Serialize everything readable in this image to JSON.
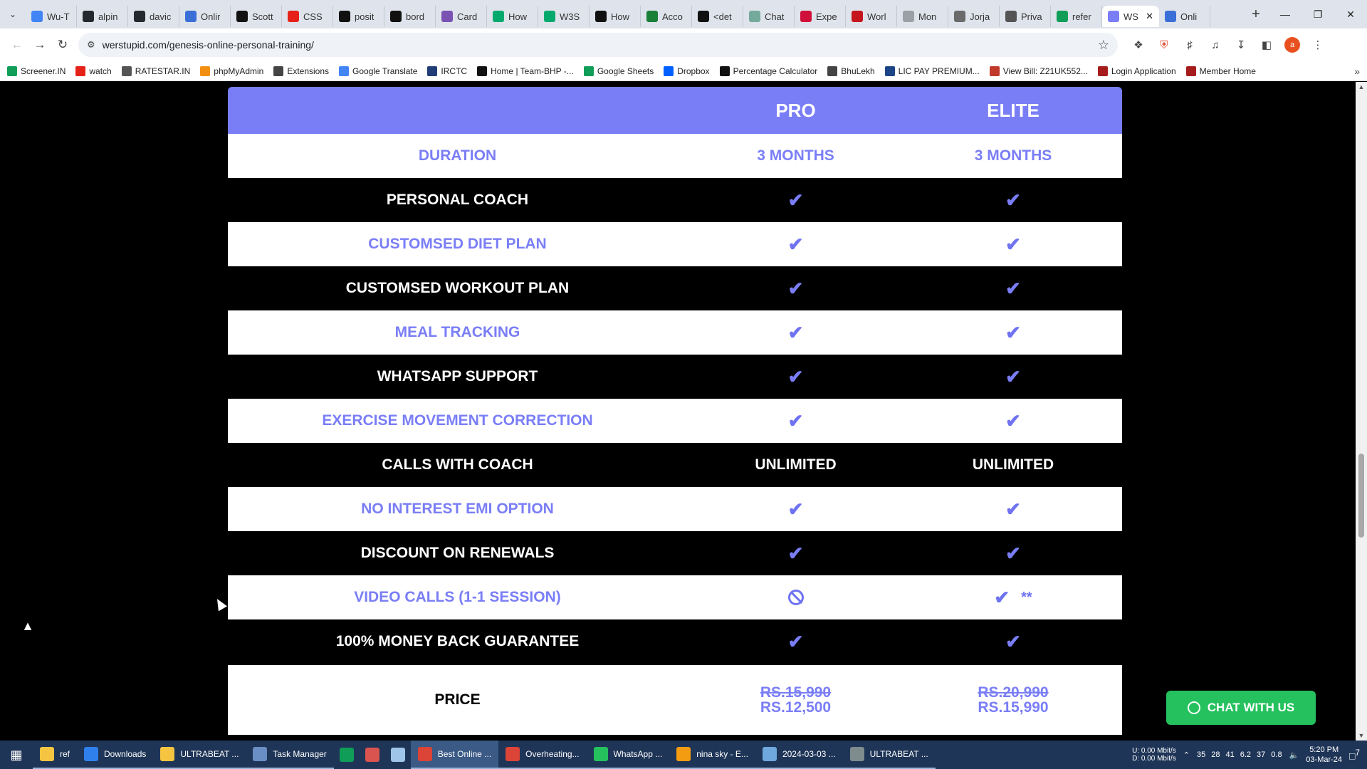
{
  "browser": {
    "tabs": [
      {
        "title": "Wu-T",
        "icon": "google-icon",
        "color": "#4285f4"
      },
      {
        "title": "alpin",
        "icon": "github-icon",
        "color": "#24292f"
      },
      {
        "title": "davic",
        "icon": "github-icon",
        "color": "#24292f"
      },
      {
        "title": "Onlir",
        "icon": "mentor-icon",
        "color": "#3b6fd8"
      },
      {
        "title": "Scott",
        "icon": "s-icon",
        "color": "#111111"
      },
      {
        "title": "CSS",
        "icon": "youtube-icon",
        "color": "#e62117"
      },
      {
        "title": "posit",
        "icon": "medium-icon",
        "color": "#111111"
      },
      {
        "title": "bord",
        "icon": "medium-icon",
        "color": "#111111"
      },
      {
        "title": "Card",
        "icon": "bootstrap-icon",
        "color": "#7952b3"
      },
      {
        "title": "How",
        "icon": "w3-icon",
        "color": "#04aa6d"
      },
      {
        "title": "W3S",
        "icon": "w3-icon",
        "color": "#04aa6d"
      },
      {
        "title": "How",
        "icon": "a-icon",
        "color": "#111111"
      },
      {
        "title": "Acco",
        "icon": "infinity-icon",
        "color": "#1a7f37"
      },
      {
        "title": "<det",
        "icon": "medium-icon",
        "color": "#111111"
      },
      {
        "title": "Chat",
        "icon": "chatgpt-icon",
        "color": "#74aa9c"
      },
      {
        "title": "Expe",
        "icon": "expe-icon",
        "color": "#d0103a"
      },
      {
        "title": "Worl",
        "icon": "news-icon",
        "color": "#c4161c"
      },
      {
        "title": "Mon",
        "icon": "cloud-icon",
        "color": "#9aa0a6"
      },
      {
        "title": "Jorja",
        "icon": "script-icon",
        "color": "#6b6b6b"
      },
      {
        "title": "Priva",
        "icon": "wiki-icon",
        "color": "#555555"
      },
      {
        "title": "refer",
        "icon": "sheets-icon",
        "color": "#0f9d58"
      },
      {
        "title": "WS",
        "icon": "ws-icon",
        "color": "#7a7ef6",
        "active": true
      },
      {
        "title": "Onli",
        "icon": "mentor-icon",
        "color": "#3b6fd8"
      }
    ],
    "new_tab": "+",
    "url": "werstupid.com/genesis-online-personal-training/",
    "profile_initial": "a"
  },
  "bookmarks": [
    {
      "label": "Screener.IN",
      "icon": "bar-chart-icon",
      "color": "#0f9d58"
    },
    {
      "label": "watch",
      "icon": "youtube-icon",
      "color": "#e62117"
    },
    {
      "label": "RATESTAR.IN",
      "icon": "star-icon",
      "color": "#555555"
    },
    {
      "label": "phpMyAdmin",
      "icon": "phpmyadmin-icon",
      "color": "#f29111"
    },
    {
      "label": "Extensions",
      "icon": "puzzle-icon",
      "color": "#444444"
    },
    {
      "label": "Google Translate",
      "icon": "translate-icon",
      "color": "#4285f4"
    },
    {
      "label": "IRCTC",
      "icon": "irctc-icon",
      "color": "#213d77"
    },
    {
      "label": "Home | Team-BHP -...",
      "icon": "teambhp-icon",
      "color": "#111111"
    },
    {
      "label": "Google Sheets",
      "icon": "sheets-icon",
      "color": "#0f9d58"
    },
    {
      "label": "Dropbox",
      "icon": "dropbox-icon",
      "color": "#0061fe"
    },
    {
      "label": "Percentage Calculator",
      "icon": "calc-icon",
      "color": "#111111"
    },
    {
      "label": "BhuLekh",
      "icon": "globe-icon",
      "color": "#444444"
    },
    {
      "label": "LIC PAY PREMIUM...",
      "icon": "lic-icon",
      "color": "#1c4587"
    },
    {
      "label": "View Bill: Z21UK552...",
      "icon": "bill-icon",
      "color": "#c0392b"
    },
    {
      "label": "Login Application",
      "icon": "login-icon",
      "color": "#a61c1c"
    },
    {
      "label": "Member Home",
      "icon": "member-icon",
      "color": "#a61c1c"
    }
  ],
  "plan_table": {
    "header": {
      "feature": "",
      "pro": "PRO",
      "elite": "ELITE"
    },
    "rows": [
      {
        "feature": "DURATION",
        "pro": "3 MONTHS",
        "elite": "3 MONTHS",
        "style": "light"
      },
      {
        "feature": "PERSONAL COACH",
        "pro": "check",
        "elite": "check",
        "style": "dark"
      },
      {
        "feature": "CUSTOMSED DIET PLAN",
        "pro": "check",
        "elite": "check",
        "style": "light"
      },
      {
        "feature": "CUSTOMSED WORKOUT PLAN",
        "pro": "check",
        "elite": "check",
        "style": "dark"
      },
      {
        "feature": "MEAL TRACKING",
        "pro": "check",
        "elite": "check",
        "style": "light"
      },
      {
        "feature": "WHATSAPP SUPPORT",
        "pro": "check",
        "elite": "check",
        "style": "dark"
      },
      {
        "feature": "EXERCISE MOVEMENT CORRECTION",
        "pro": "check",
        "elite": "check",
        "style": "light"
      },
      {
        "feature": "CALLS WITH COACH",
        "pro": "UNLIMITED",
        "elite": "UNLIMITED",
        "style": "dark"
      },
      {
        "feature": "NO INTEREST EMI OPTION",
        "pro": "check",
        "elite": "check",
        "style": "light"
      },
      {
        "feature": "DISCOUNT ON RENEWALS",
        "pro": "check",
        "elite": "check",
        "style": "dark"
      },
      {
        "feature": "VIDEO CALLS (1-1 SESSION)",
        "pro": "not-included",
        "elite": "check",
        "elite_note": "**",
        "style": "light"
      },
      {
        "feature": "100% MONEY BACK GUARANTEE",
        "pro": "check",
        "elite": "check",
        "style": "dark"
      }
    ],
    "price": {
      "label": "PRICE",
      "pro_old": "Rs.15,990",
      "pro_new": "Rs.12,500",
      "elite_old": "Rs.20,990",
      "elite_new": "Rs.15,990"
    },
    "accent_color": "#7a7ef6"
  },
  "chat_button": {
    "label": "CHAT WITH US",
    "icon": "whatsapp-icon",
    "color": "#25c15e"
  },
  "taskbar": {
    "items": [
      {
        "label": "ref",
        "icon": "folder-icon",
        "color": "#f5c542"
      },
      {
        "label": "Downloads",
        "icon": "download-icon",
        "color": "#2f80ed"
      },
      {
        "label": "ULTRABEAT ...",
        "icon": "folder-icon",
        "color": "#f5c542"
      },
      {
        "label": "Task Manager",
        "icon": "taskmanager-icon",
        "color": "#6a8fc4"
      },
      {
        "label": "",
        "icon": "sheets-icon",
        "color": "#0f9d58"
      },
      {
        "label": "",
        "icon": "app-icon",
        "color": "#d9534f"
      },
      {
        "label": "",
        "icon": "notepad-icon",
        "color": "#9fc5e8"
      },
      {
        "label": "Best Online ...",
        "icon": "chrome-icon",
        "color": "#db4437",
        "active": true
      },
      {
        "label": "Overheating...",
        "icon": "chrome-icon",
        "color": "#db4437"
      },
      {
        "label": "WhatsApp ...",
        "icon": "whatsapp-icon",
        "color": "#25c15e"
      },
      {
        "label": "nina sky - E...",
        "icon": "search-icon",
        "color": "#f39c12"
      },
      {
        "label": "2024-03-03 ...",
        "icon": "image-icon",
        "color": "#6fa8dc"
      },
      {
        "label": "ULTRABEAT ...",
        "icon": "winamp-icon",
        "color": "#7f8c8d"
      }
    ],
    "network": {
      "up_label": "U:",
      "up": "0.00 Mbit/s",
      "down_label": "D:",
      "down": "0.00 Mbit/s"
    },
    "tray_numbers": [
      "35",
      "28",
      "41",
      "6.2",
      "37",
      "0.8"
    ],
    "time": "5:20 PM",
    "date": "03-Mar-24",
    "notifications": "7"
  }
}
